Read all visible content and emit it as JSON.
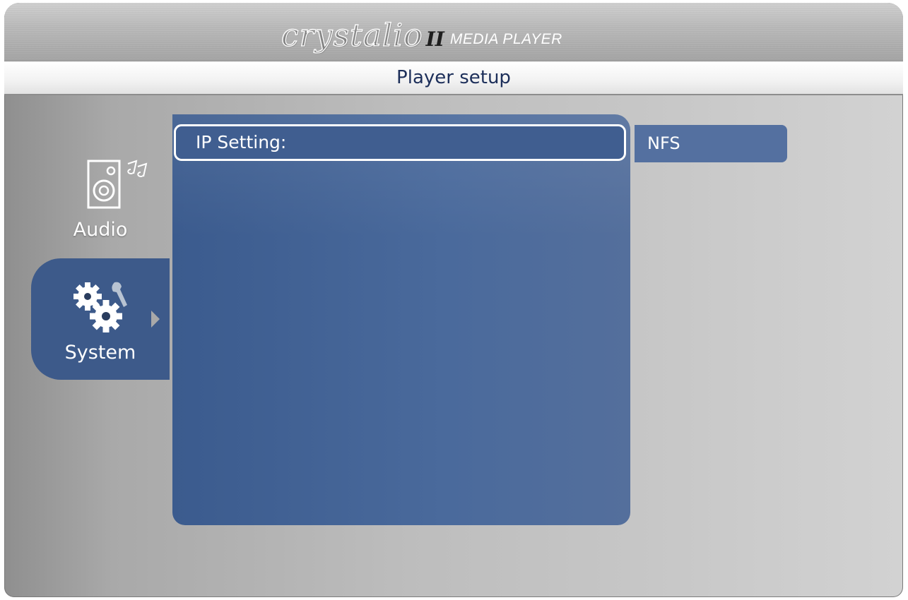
{
  "header": {
    "logo_text": "crystalio",
    "logo_numeral": "II",
    "logo_sub": "MEDIA PLAYER"
  },
  "title_bar": {
    "title": "Player setup"
  },
  "sidebar": {
    "items": [
      {
        "label": "Audio",
        "icon": "speaker-music-icon",
        "selected": false
      },
      {
        "label": "System",
        "icon": "gears-wrench-icon",
        "selected": true
      }
    ]
  },
  "main": {
    "rows": [
      {
        "label": "IP Setting:",
        "value": "NFS",
        "focused": true
      }
    ]
  },
  "colors": {
    "panel_blue": "#3d5a8a",
    "value_blue": "#5470a0",
    "title_text": "#1d2f5a"
  }
}
